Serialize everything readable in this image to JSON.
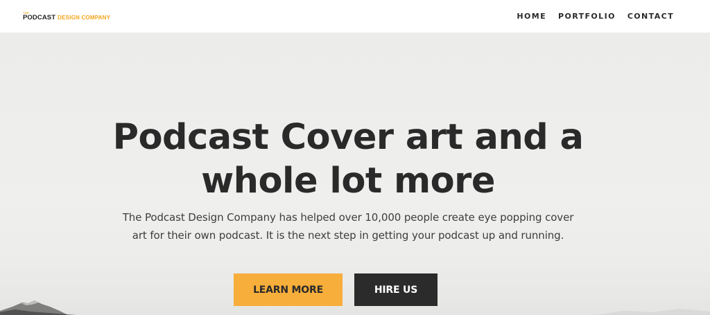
{
  "header": {
    "logo": {
      "small": "THE",
      "main": "PODCAST",
      "accent": "DESIGN COMPANY"
    },
    "nav": [
      {
        "label": "HOME"
      },
      {
        "label": "PORTFOLIO"
      },
      {
        "label": "CONTACT"
      }
    ]
  },
  "hero": {
    "headline_line1": "Podcast Cover art and a",
    "headline_line2": "whole lot more",
    "subtext_line1": "The Podcast Design Company has helped over 10,000 people create eye popping cover",
    "subtext_line2": "art for their own podcast. It is the next step in getting your podcast up and running.",
    "primary_button": "LEARN MORE",
    "secondary_button": "HIRE US"
  },
  "colors": {
    "accent": "#f7ae3b",
    "dark": "#2b2b2b",
    "background": "#ededeb"
  }
}
